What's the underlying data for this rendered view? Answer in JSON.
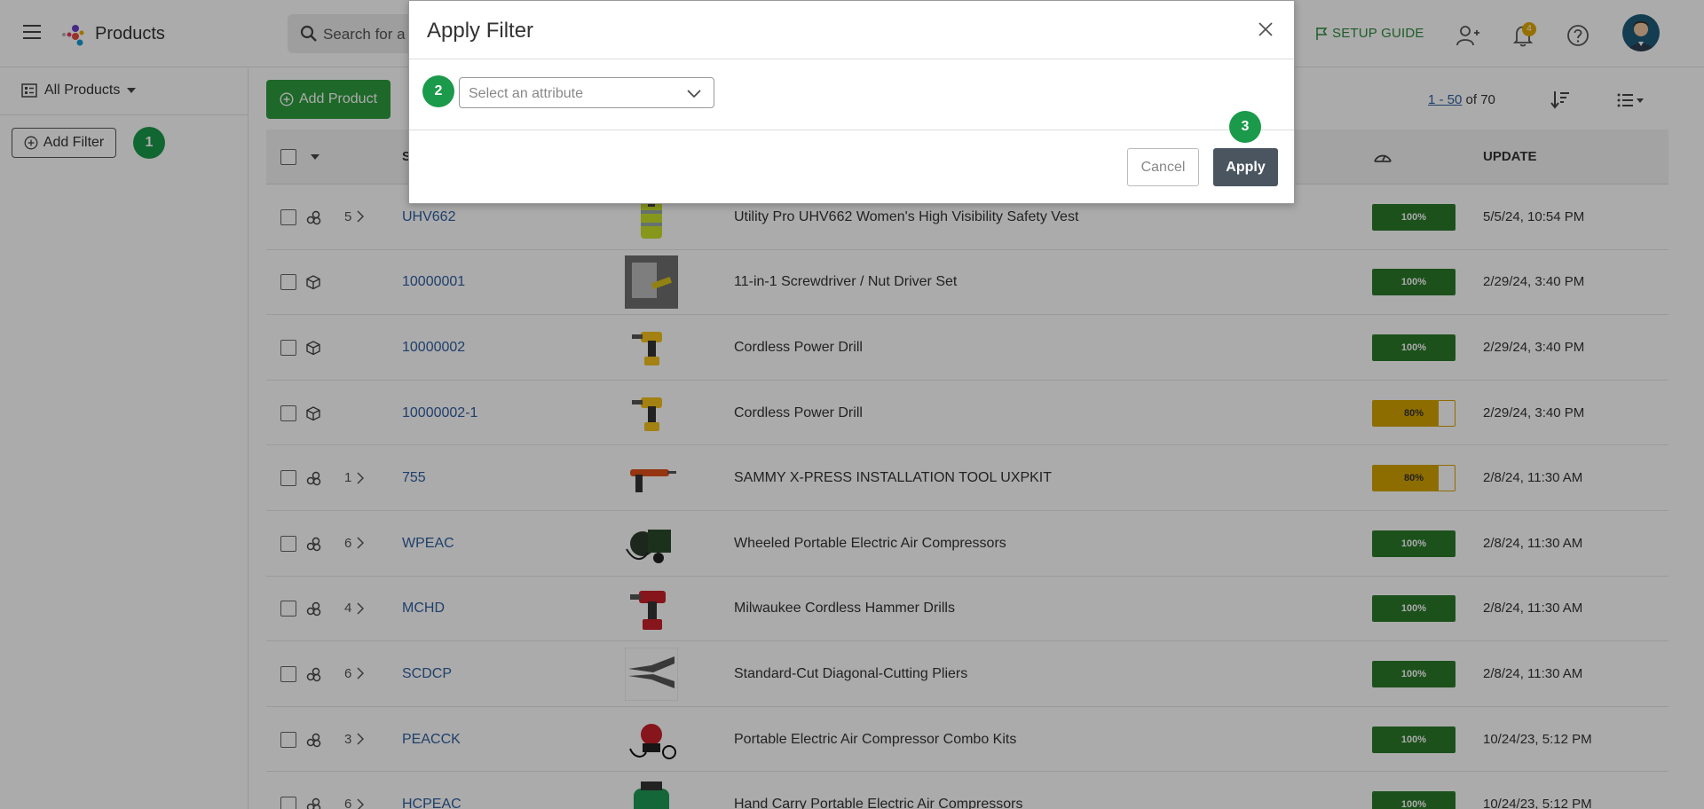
{
  "header": {
    "app_title": "Products",
    "search_placeholder": "Search for a",
    "setup_guide": "SETUP GUIDE",
    "notification_count": "4"
  },
  "sidebar": {
    "view_label": "All Products",
    "add_filter_label": "Add Filter",
    "step_badge": "1"
  },
  "toolbar": {
    "add_product_label": "Add Product",
    "pager_range": "1 - 50",
    "pager_total": "of 70"
  },
  "table": {
    "col_sku": "S",
    "col_update": "UPDATE",
    "rows": [
      {
        "variants": "5",
        "sku": "UHV662",
        "name": "Utility Pro UHV662 Women's High Visibility Safety Vest",
        "score": "100%",
        "score_pct": 100,
        "updated": "5/5/24, 10:54 PM",
        "thumb": "vest",
        "type": "group"
      },
      {
        "variants": "",
        "sku": "10000001",
        "name": "11-in-1 Screwdriver / Nut Driver Set",
        "score": "100%",
        "score_pct": 100,
        "updated": "2/29/24, 3:40 PM",
        "thumb": "screwdriver",
        "type": "single"
      },
      {
        "variants": "",
        "sku": "10000002",
        "name": "Cordless Power Drill",
        "score": "100%",
        "score_pct": 100,
        "updated": "2/29/24, 3:40 PM",
        "thumb": "drill",
        "type": "single"
      },
      {
        "variants": "",
        "sku": "10000002-1",
        "name": "Cordless Power Drill",
        "score": "80%",
        "score_pct": 80,
        "updated": "2/29/24, 3:40 PM",
        "thumb": "drill",
        "type": "single"
      },
      {
        "variants": "1",
        "sku": "755",
        "name": "SAMMY X-PRESS INSTALLATION TOOL UXPKIT",
        "score": "80%",
        "score_pct": 80,
        "updated": "2/8/24, 11:30 AM",
        "thumb": "gun",
        "type": "group"
      },
      {
        "variants": "6",
        "sku": "WPEAC",
        "name": "Wheeled Portable Electric Air Compressors",
        "score": "100%",
        "score_pct": 100,
        "updated": "2/8/24, 11:30 AM",
        "thumb": "compressor",
        "type": "group"
      },
      {
        "variants": "4",
        "sku": "MCHD",
        "name": "Milwaukee Cordless Hammer Drills",
        "score": "100%",
        "score_pct": 100,
        "updated": "2/8/24, 11:30 AM",
        "thumb": "reddrill",
        "type": "group"
      },
      {
        "variants": "6",
        "sku": "SCDCP",
        "name": "Standard-Cut Diagonal-Cutting Pliers",
        "score": "100%",
        "score_pct": 100,
        "updated": "2/8/24, 11:30 AM",
        "thumb": "pliers",
        "type": "group"
      },
      {
        "variants": "3",
        "sku": "PEACCK",
        "name": "Portable Electric Air Compressor Combo Kits",
        "score": "100%",
        "score_pct": 100,
        "updated": "10/24/23, 5:12 PM",
        "thumb": "redcomp",
        "type": "group"
      },
      {
        "variants": "6",
        "sku": "HCPEAC",
        "name": "Hand Carry Portable Electric Air Compressors",
        "score": "100%",
        "score_pct": 100,
        "updated": "10/24/23, 5:12 PM",
        "thumb": "greencomp",
        "type": "group"
      }
    ]
  },
  "modal": {
    "title": "Apply Filter",
    "attribute_placeholder": "Select an attribute",
    "step_2": "2",
    "step_3": "3",
    "cancel_label": "Cancel",
    "apply_label": "Apply"
  },
  "colors": {
    "primary_green": "#2e9c3e",
    "step_badge": "#1a9a4a",
    "score_full": "#2a7a2a",
    "score_partial": "#d4a300",
    "link_blue": "#2f5fa0",
    "apply_button": "#4a5560"
  }
}
